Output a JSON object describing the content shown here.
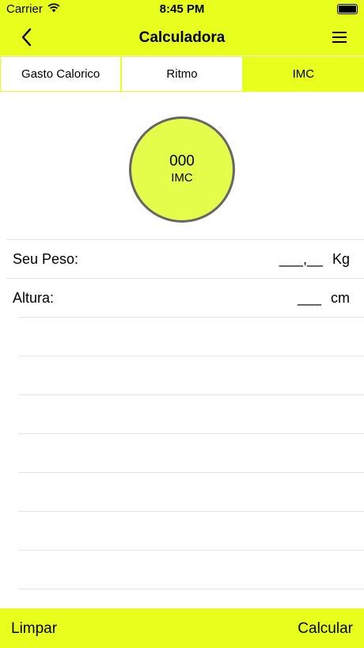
{
  "status_bar": {
    "carrier": "Carrier",
    "time": "8:45 PM"
  },
  "nav": {
    "title": "Calculadora",
    "back_icon": "chevron-left-icon",
    "menu_icon": "hamburger-menu-icon"
  },
  "tabs": [
    {
      "label": "Gasto Calorico",
      "active": false
    },
    {
      "label": "Ritmo",
      "active": false
    },
    {
      "label": "IMC",
      "active": true
    }
  ],
  "result": {
    "value": "000",
    "unit": "IMC"
  },
  "fields": {
    "weight": {
      "label": "Seu Peso:",
      "value": "___,__",
      "unit": "Kg"
    },
    "height": {
      "label": "Altura:",
      "value": "___",
      "unit": "cm"
    }
  },
  "bottom": {
    "clear_label": "Limpar",
    "calculate_label": "Calcular"
  },
  "colors": {
    "accent": "#e8ff1e",
    "circle_fill": "#e3fd4a",
    "circle_border": "#666666",
    "separator": "#e4e4e4"
  }
}
